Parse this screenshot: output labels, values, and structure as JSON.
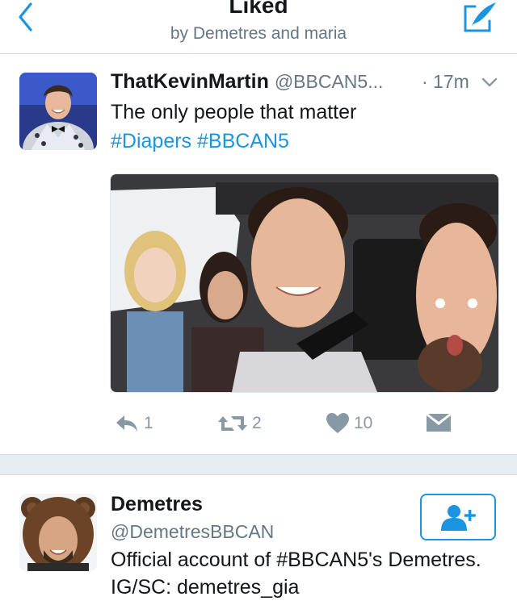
{
  "header": {
    "title": "Liked",
    "subtitle": "by Demetres and maria",
    "back_icon": "chevron-left-icon",
    "compose_icon": "compose-quill-icon",
    "accent_color": "#1b95e0"
  },
  "tweet": {
    "name": "ThatKevinMartin",
    "handle": "@BBCAN5...",
    "time": "· 17m",
    "text": "The only people that matter",
    "hashtags": [
      "#Diapers",
      "#BBCAN5"
    ],
    "media_description_icon": "photo",
    "actions": {
      "reply_count": "1",
      "retweet_count": "2",
      "like_count": "10"
    }
  },
  "user_card": {
    "name": "Demetres",
    "handle": "@DemetresBBCAN",
    "bio": "Official account of #BBCAN5's Demetres. IG/SC: demetres_gia",
    "follow_icon": "add-user-icon"
  }
}
